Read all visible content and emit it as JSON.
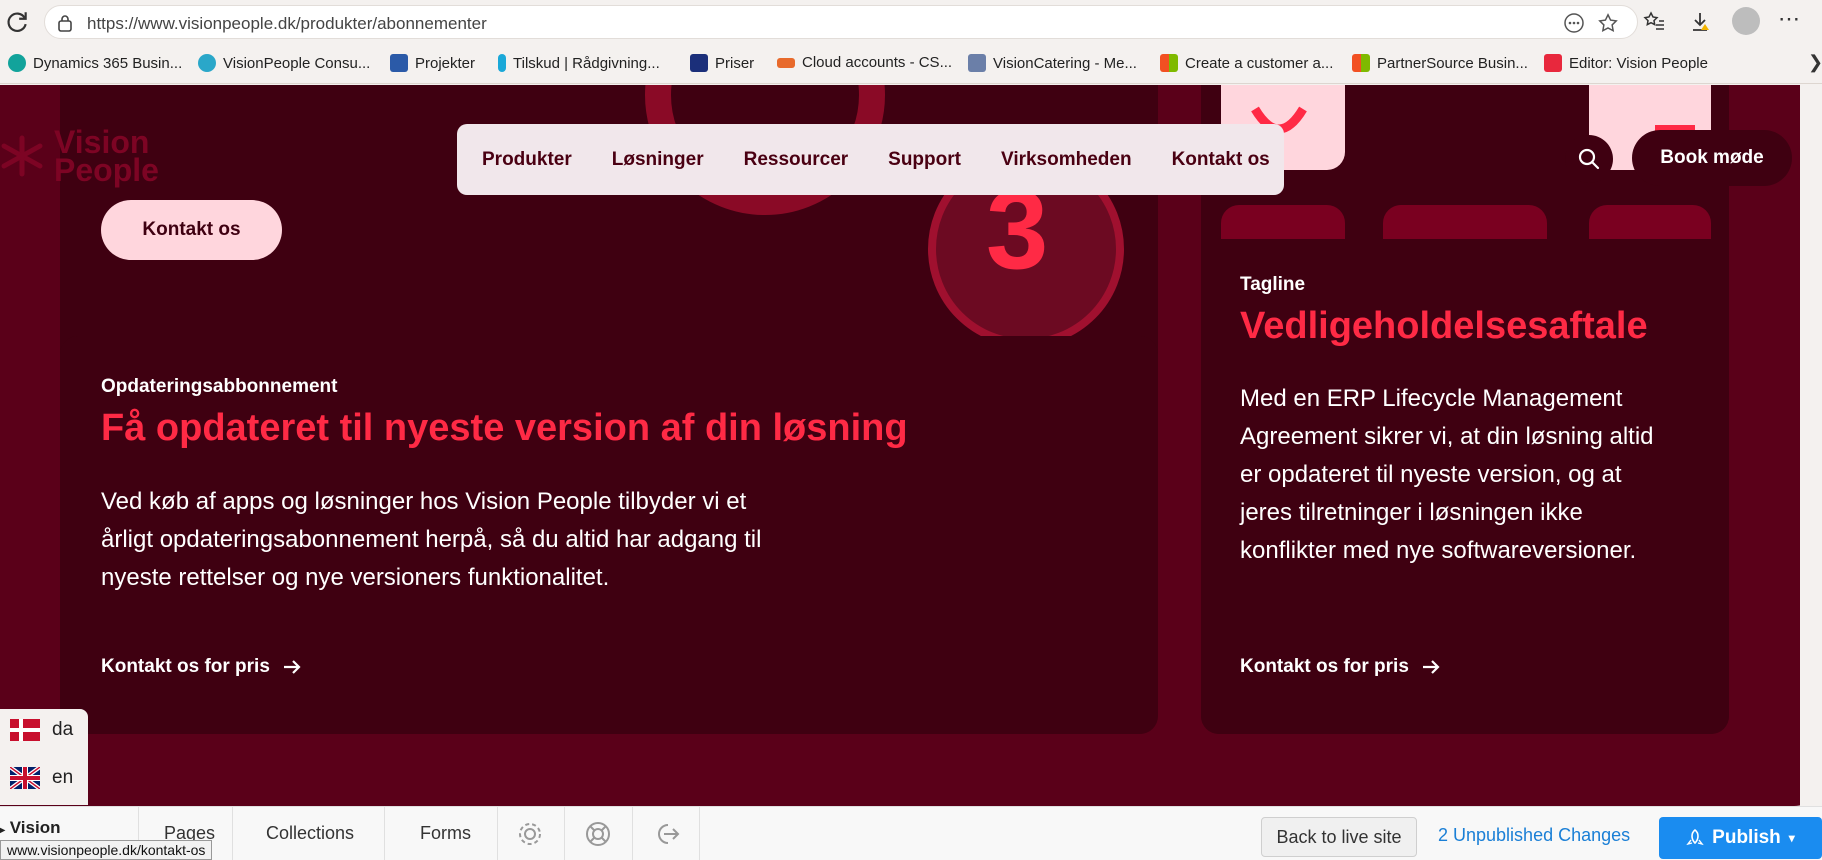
{
  "browser": {
    "url": "https://www.visionpeople.dk/produkter/abonnementer",
    "bookmarks": [
      {
        "label": "Dynamics 365 Busin...",
        "color": "#12a39b"
      },
      {
        "label": "VisionPeople Consu...",
        "color": "#2aa7c9"
      },
      {
        "label": "Projekter",
        "color": "#2b5aa8"
      },
      {
        "label": "Tilskud | Rådgivning...",
        "color": "#1aa8d8"
      },
      {
        "label": "Priser",
        "color": "#1b2f7a"
      },
      {
        "label": "Cloud accounts - CS...",
        "color": "#e86a2b"
      },
      {
        "label": "VisionCatering - Me...",
        "color": "#6b7fa8"
      },
      {
        "label": "Create a customer a...",
        "color": "#f25022"
      },
      {
        "label": "PartnerSource Busin...",
        "color": "#f25022"
      },
      {
        "label": "Editor: Vision People",
        "color": "#e8283d"
      }
    ]
  },
  "site": {
    "logo_line1": "Vision",
    "logo_line2": "People",
    "nav": [
      "Produkter",
      "Løsninger",
      "Ressourcer",
      "Support",
      "Virksomheden",
      "Kontakt os"
    ],
    "book_label": "Book møde",
    "contact_label": "Kontakt os",
    "big_number": "3"
  },
  "cards": {
    "left": {
      "kicker": "Opdateringsabbonnement",
      "headline": "Få opdateret til nyeste version af din løsning",
      "body": "Ved køb af apps og løsninger hos Vision People tilbyder vi et årligt opdateringsabonnement herpå, så du altid har adgang til nyeste rettelser og nye versioners funktionalitet.",
      "link": "Kontakt os for pris"
    },
    "right": {
      "kicker": "Tagline",
      "headline": "Vedligeholdelsesaftale",
      "body": "Med en ERP Lifecycle Management Agreement sikrer vi, at din løsning altid er opdateret til nyeste version, og at jeres tilretninger i løsningen ikke konflikter med nye softwareversioner.",
      "link": "Kontakt os for pris"
    }
  },
  "languages": [
    {
      "code": "da"
    },
    {
      "code": "en"
    }
  ],
  "editor": {
    "vision_label": "Vision",
    "pages_label": "Pages",
    "collections_label": "Collections",
    "forms_label": "Forms",
    "back_label": "Back to live site",
    "unpublished_label": "2 Unpublished Changes",
    "publish_label": "Publish",
    "status_url": "www.visionpeople.dk/kontakt-os"
  },
  "colors": {
    "page_bg": "#5a0019",
    "card_bg": "#3f0011",
    "accent_red": "#ff2a45",
    "pink": "#ffd6dd",
    "publish_blue": "#1a8cf0"
  }
}
